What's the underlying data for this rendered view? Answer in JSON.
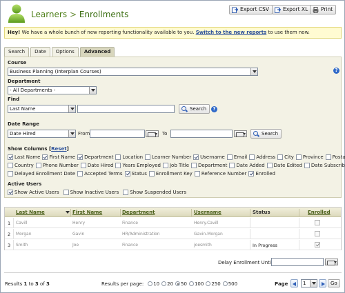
{
  "header": {
    "section": "Learners",
    "separator": ">",
    "page": "Enrollments",
    "buttons": {
      "export_csv": "Export CSV",
      "export_xl": "Export XL",
      "print": "Print"
    }
  },
  "notice": {
    "prefix": "Hey!",
    "text": " We have a whole bunch of new reporting functionality available to you.",
    "link": "Switch to the new reports",
    "suffix": " to use them now."
  },
  "tabs": [
    "Search",
    "Date",
    "Options",
    "Advanced"
  ],
  "active_tab": "Advanced",
  "filters": {
    "course_label": "Course",
    "course_value": "Business Planning  (Interplan Courses)",
    "department_label": "Department",
    "department_value": "- All Departments -",
    "find_label": "Find",
    "find_field": "Last Name",
    "find_value": "",
    "search_label": "Search",
    "date_range_label": "Date Range",
    "date_field": "Date Hired",
    "from_label": "From",
    "to_label": "To",
    "from_value": "",
    "to_value": ""
  },
  "show_columns": {
    "label": "Show Columns",
    "reset": "Reset",
    "rows": [
      [
        {
          "label": "Last Name",
          "checked": true
        },
        {
          "label": "First Name",
          "checked": true
        },
        {
          "label": "Department",
          "checked": true
        },
        {
          "label": "Location",
          "checked": false
        },
        {
          "label": "Learner Number",
          "checked": false
        },
        {
          "label": "Username",
          "checked": true
        },
        {
          "label": "Email",
          "checked": false
        },
        {
          "label": "Address",
          "checked": false
        },
        {
          "label": "City",
          "checked": false
        },
        {
          "label": "Province",
          "checked": false
        },
        {
          "label": "Postal Code",
          "checked": false
        }
      ],
      [
        {
          "label": "Country",
          "checked": false
        },
        {
          "label": "Phone Number",
          "checked": false
        },
        {
          "label": "Date Hired",
          "checked": false
        },
        {
          "label": "Years Employed",
          "checked": false
        },
        {
          "label": "Job Title",
          "checked": false
        },
        {
          "label": "Department",
          "checked": false
        },
        {
          "label": "Date Added",
          "checked": false
        },
        {
          "label": "Date Edited",
          "checked": false
        },
        {
          "label": "Date Subscribed",
          "checked": false
        }
      ],
      [
        {
          "label": "Delayed Enrollment Date",
          "checked": false
        },
        {
          "label": "Accepted Terms",
          "checked": false
        },
        {
          "label": "Status",
          "checked": true
        },
        {
          "label": "Enrollment Key",
          "checked": false
        },
        {
          "label": "Reference Number",
          "checked": false
        },
        {
          "label": "Enrolled",
          "checked": true
        }
      ]
    ]
  },
  "active_users": {
    "label": "Active Users",
    "options": [
      {
        "label": "Show Active Users",
        "checked": true
      },
      {
        "label": "Show Inactive Users",
        "checked": false
      },
      {
        "label": "Show Suspended Users",
        "checked": false
      }
    ]
  },
  "table": {
    "headers": [
      "Last Name",
      "First Name",
      "Department",
      "Username",
      "Status",
      "Enrolled"
    ],
    "rows": [
      {
        "num": "1",
        "last": "Cavill",
        "first": "Henry",
        "dept": "Finance",
        "user": "Henry.Cavill",
        "status": "",
        "enrolled": false
      },
      {
        "num": "2",
        "last": "Morgan",
        "first": "Gavin",
        "dept": "HR/Administration",
        "user": "Gavin.Morgan",
        "status": "",
        "enrolled": false
      },
      {
        "num": "3",
        "last": "Smith",
        "first": "Joe",
        "dept": "Finance",
        "user": "joesmith",
        "status": "In Progress",
        "enrolled": true
      }
    ]
  },
  "delay": {
    "label": "Delay Enrollment Until:",
    "value": ""
  },
  "footer": {
    "results_prefix": "Results",
    "range_start": "1",
    "range_to": "to",
    "range_end": "3",
    "of": "of",
    "total": "3",
    "per_page_label": "Results per page:",
    "per_page_options": [
      "10",
      "20",
      "50",
      "100",
      "250",
      "500"
    ],
    "per_page_selected": "50",
    "page_label": "Page",
    "page_value": "1",
    "go_label": "Go"
  },
  "colors": {
    "accent_green": "#4d7f18",
    "panel_bg": "#f3f2e5",
    "notice_bg": "#fffbd2",
    "link_blue": "#2a4f9a"
  }
}
